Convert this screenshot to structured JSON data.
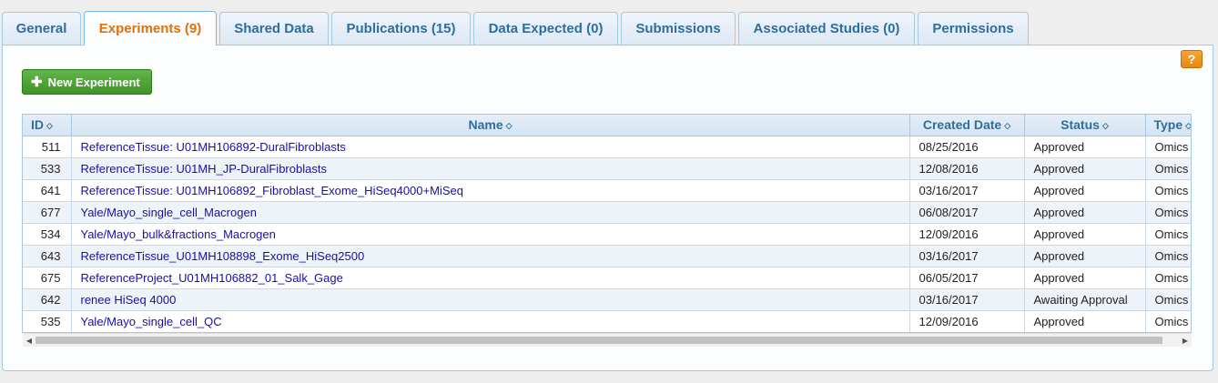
{
  "tabs": [
    {
      "label": "General"
    },
    {
      "label": "Experiments (9)",
      "active": true
    },
    {
      "label": "Shared Data"
    },
    {
      "label": "Publications (15)"
    },
    {
      "label": "Data Expected (0)"
    },
    {
      "label": "Submissions"
    },
    {
      "label": "Associated Studies (0)"
    },
    {
      "label": "Permissions"
    }
  ],
  "help_label": "?",
  "new_button": {
    "icon": "plus-icon",
    "label": "New Experiment"
  },
  "table": {
    "columns": [
      "ID",
      "Name",
      "Created Date",
      "Status",
      "Type"
    ],
    "rows": [
      {
        "id": "511",
        "name": "ReferenceTissue: U01MH106892-DuralFibroblasts",
        "date": "08/25/2016",
        "status": "Approved",
        "type": "Omics"
      },
      {
        "id": "533",
        "name": "ReferenceTissue: U01MH_JP-DuralFibroblasts",
        "date": "12/08/2016",
        "status": "Approved",
        "type": "Omics"
      },
      {
        "id": "641",
        "name": "ReferenceTissue: U01MH106892_Fibroblast_Exome_HiSeq4000+MiSeq",
        "date": "03/16/2017",
        "status": "Approved",
        "type": "Omics"
      },
      {
        "id": "677",
        "name": "Yale/Mayo_single_cell_Macrogen",
        "date": "06/08/2017",
        "status": "Approved",
        "type": "Omics"
      },
      {
        "id": "534",
        "name": "Yale/Mayo_bulk&fractions_Macrogen",
        "date": "12/09/2016",
        "status": "Approved",
        "type": "Omics"
      },
      {
        "id": "643",
        "name": "ReferenceTissue_U01MH108898_Exome_HiSeq2500",
        "date": "03/16/2017",
        "status": "Approved",
        "type": "Omics"
      },
      {
        "id": "675",
        "name": "ReferenceProject_U01MH106882_01_Salk_Gage",
        "date": "06/05/2017",
        "status": "Approved",
        "type": "Omics"
      },
      {
        "id": "642",
        "name": "renee HiSeq 4000",
        "date": "03/16/2017",
        "status": "Awaiting Approval",
        "type": "Omics"
      },
      {
        "id": "535",
        "name": "Yale/Mayo_single_cell_QC",
        "date": "12/09/2016",
        "status": "Approved",
        "type": "Omics"
      }
    ]
  },
  "colors": {
    "tab_text": "#2e6e9e",
    "active_tab_text": "#e17009",
    "link": "#1a0dab",
    "button_green": "#4ea536",
    "help_orange": "#f0941f"
  }
}
